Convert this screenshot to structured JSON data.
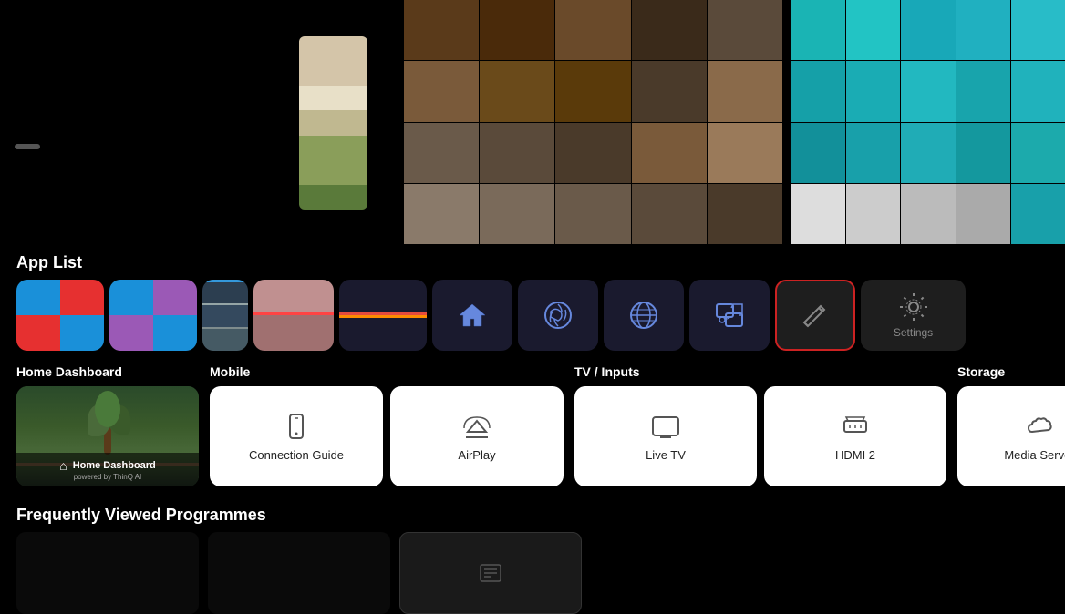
{
  "background": "#000000",
  "topThumb": {
    "label": ""
  },
  "appList": {
    "sectionLabel": "App List"
  },
  "sections": {
    "homeDashboard": {
      "label": "Home Dashboard",
      "items": [
        {
          "id": "home-dashboard",
          "title": "Home Dashboard",
          "subtitle": "powered by ThinQ AI"
        }
      ]
    },
    "mobile": {
      "label": "Mobile",
      "items": [
        {
          "id": "connection-guide",
          "title": "Connection Guide"
        },
        {
          "id": "airplay",
          "title": "AirPlay"
        }
      ]
    },
    "tvInputs": {
      "label": "TV / Inputs",
      "items": [
        {
          "id": "live-tv",
          "title": "Live TV"
        },
        {
          "id": "hdmi-2",
          "title": "HDMI 2"
        }
      ]
    },
    "storage": {
      "label": "Storage",
      "items": [
        {
          "id": "media-server",
          "title": "Media Server"
        }
      ]
    }
  },
  "frequentlyViewed": {
    "label": "Frequently Viewed Programmes"
  },
  "icons": {
    "homeDashboard": "⌂",
    "connectionGuide": "📱",
    "airplay": "▲",
    "liveTV": "🖥",
    "hdmi2": "⊟",
    "mediaServer": "☁",
    "edit": "✏",
    "settings": "⚙",
    "settingsLabel": "Settings",
    "home": "⌂",
    "sports": "⚽",
    "globe": "🌐",
    "music": "♪",
    "listIcon": "≡"
  },
  "appTiles": {
    "colors1": [
      "#1a90d9",
      "#e63030",
      "#1a90d9",
      "#e63030"
    ],
    "colors2": [
      "#1a90d9",
      "#9b59b6",
      "#9b59b6",
      "#1a90d9"
    ],
    "colors3": [
      "#2c3e50",
      "#34495e",
      "#455a64"
    ],
    "colors4": [
      "#d4a96a",
      "#b8785a"
    ],
    "colors5_bluestripe": "#2c3e50",
    "colors6": [
      "#e74c3c",
      "#ff6b35"
    ]
  },
  "bgThumbs": {
    "block2colors": [
      "#d4c5a9",
      "#c8b99a",
      "#e8e0c8",
      "#b8a87a",
      "#8a9e5a",
      "#5a7a3a"
    ],
    "block3colors": [
      "#5a3a1a",
      "#4a2a0a",
      "#6a4a2a",
      "#3a2a1a",
      "#5a4a3a",
      "#7a5a3a",
      "#6a4a1a",
      "#5a3a0a",
      "#4a3a2a",
      "#8a6a4a",
      "#6a5a4a",
      "#5a4a3a",
      "#4a3a2a",
      "#7a5a3a",
      "#9a7a5a",
      "#8a7a6a",
      "#7a6a5a",
      "#6a5a4a",
      "#5a4a3a",
      "#4a3a2a"
    ],
    "block4colors": [
      "#1ab4b4",
      "#22c4c4",
      "#18a8b8",
      "#20b0c0",
      "#28bcc8",
      "#15a0a8",
      "#1aacb4",
      "#22b8c0",
      "#18a4ac",
      "#20b2bc",
      "#12909a",
      "#18a0aa",
      "#20acb6",
      "#14989e",
      "#1caaaC",
      "#ddd",
      "#ccc",
      "#bbb",
      "#aaa",
      "#18a0aa"
    ]
  }
}
